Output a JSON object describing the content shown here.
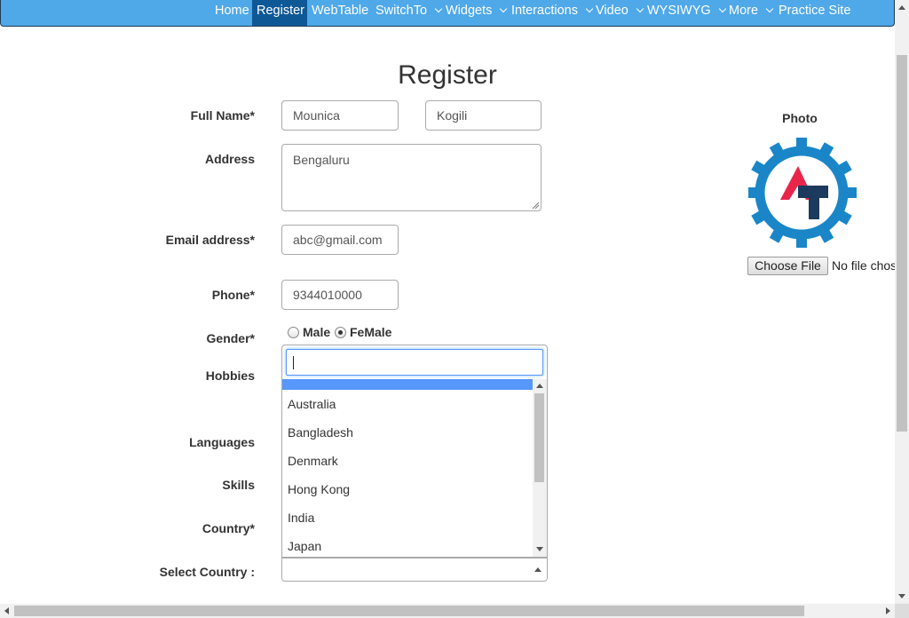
{
  "nav": {
    "items": [
      {
        "label": "Home",
        "dropdown": false,
        "active": false
      },
      {
        "label": "Register",
        "dropdown": false,
        "active": true
      },
      {
        "label": "WebTable",
        "dropdown": false,
        "active": false
      },
      {
        "label": "SwitchTo",
        "dropdown": true,
        "active": false
      },
      {
        "label": "Widgets",
        "dropdown": true,
        "active": false
      },
      {
        "label": "Interactions",
        "dropdown": true,
        "active": false
      },
      {
        "label": "Video",
        "dropdown": true,
        "active": false
      },
      {
        "label": "WYSIWYG",
        "dropdown": true,
        "active": false
      },
      {
        "label": "More",
        "dropdown": true,
        "active": false
      },
      {
        "label": "Practice Site",
        "dropdown": false,
        "active": false
      }
    ]
  },
  "page": {
    "title": "Register"
  },
  "form": {
    "full_name_label": "Full Name*",
    "first_name": "Mounica",
    "last_name": "Kogili",
    "address_label": "Address",
    "address": "Bengaluru",
    "email_label": "Email address*",
    "email": "abc@gmail.com",
    "phone_label": "Phone*",
    "phone": "9344010000",
    "gender_label": "Gender*",
    "gender_options": [
      "Male",
      "FeMale"
    ],
    "gender_selected": "FeMale",
    "hobbies_label": "Hobbies",
    "languages_label": "Languages",
    "skills_label": "Skills",
    "country_label": "Country*",
    "select_country_label": "Select Country :"
  },
  "country_dropdown": {
    "search_value": "",
    "options": [
      "Australia",
      "Bangladesh",
      "Denmark",
      "Hong Kong",
      "India",
      "Japan"
    ]
  },
  "photo": {
    "label": "Photo",
    "choose_file_label": "Choose File",
    "no_file_text": "No file chosen"
  },
  "colors": {
    "nav_bg": "#4fa8e8",
    "nav_active": "#0e5896",
    "logo_blue": "#1a86c8",
    "logo_red": "#e8264a",
    "logo_navy": "#1c3a5e",
    "highlight": "#5897fb"
  }
}
